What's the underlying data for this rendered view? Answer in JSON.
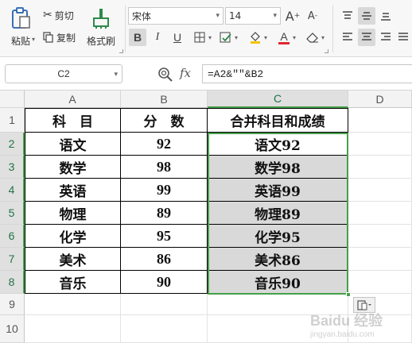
{
  "ribbon": {
    "paste_label": "粘贴",
    "cut_label": "剪切",
    "copy_label": "复制",
    "format_painter_label": "格式刷",
    "font_name": "宋体",
    "font_size": "14",
    "bold": "B",
    "italic": "I",
    "underline": "U",
    "font_color_letter": "A",
    "grow_font": "A",
    "shrink_font": "A"
  },
  "formula_bar": {
    "cell_ref": "C2",
    "fx": "fx",
    "formula": "=A2&\"\"&B2"
  },
  "columns": [
    "A",
    "B",
    "C",
    "D"
  ],
  "rows": [
    "1",
    "2",
    "3",
    "4",
    "5",
    "6",
    "7",
    "8",
    "9",
    "10"
  ],
  "table": {
    "headers": [
      "科　目",
      "分　数",
      "合并科目和成绩"
    ],
    "rows": [
      [
        "语文",
        "92",
        "语文92"
      ],
      [
        "数学",
        "98",
        "数学98"
      ],
      [
        "英语",
        "99",
        "英语99"
      ],
      [
        "物理",
        "89",
        "物理89"
      ],
      [
        "化学",
        "95",
        "化学95"
      ],
      [
        "美术",
        "86",
        "美术86"
      ],
      [
        "音乐",
        "90",
        "音乐90"
      ]
    ]
  },
  "watermark": {
    "line1": "Baidu 经验",
    "line2": "jingyan.baidu.com"
  },
  "colors": {
    "selection": "#47a04a",
    "shaded": "#d9d9d9",
    "header_bg": "#f3f3f3"
  },
  "icons": [
    "paste-icon",
    "scissors-icon",
    "copy-icon",
    "brush-icon",
    "zoom-icon",
    "paste-options-icon"
  ]
}
